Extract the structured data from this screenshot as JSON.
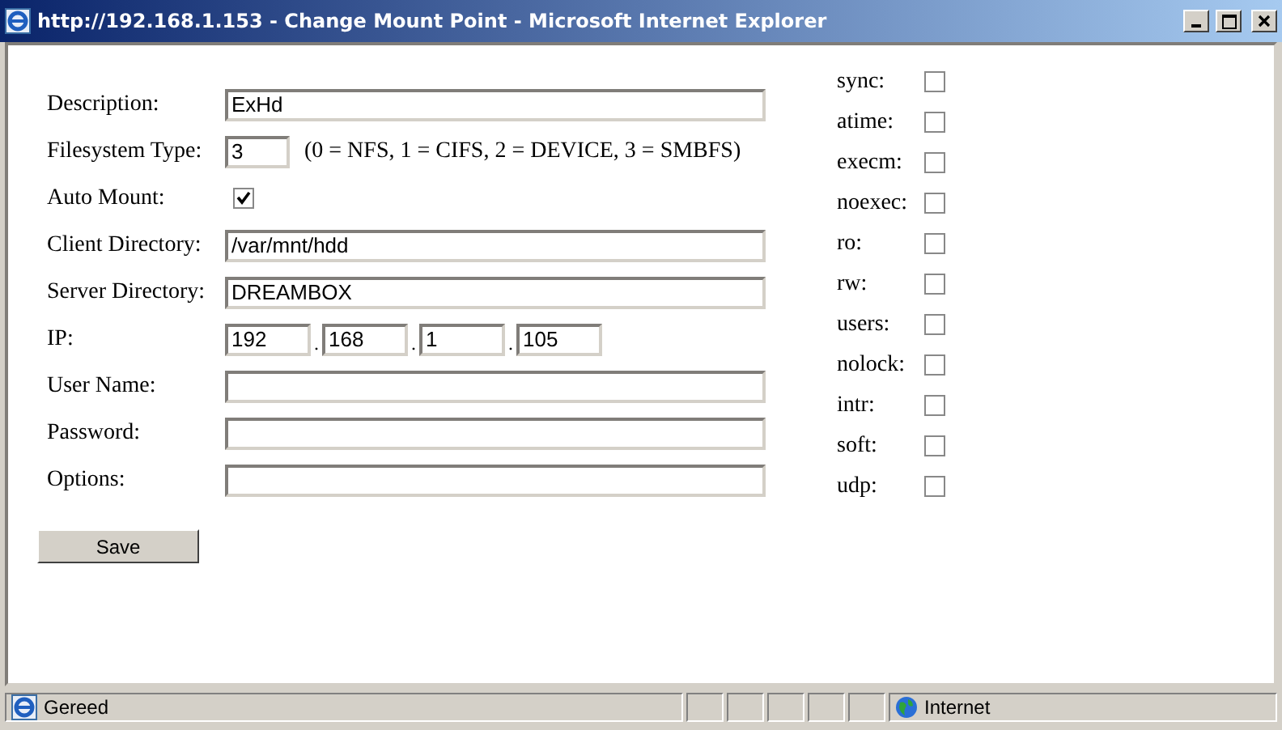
{
  "window": {
    "title": "http://192.168.1.153 - Change Mount Point - Microsoft Internet Explorer"
  },
  "form": {
    "fields": [
      {
        "kind": "text",
        "label": "Description:",
        "value": "ExHd"
      },
      {
        "kind": "short",
        "label": "Filesystem Type:",
        "value": "3",
        "note": "(0 = NFS, 1 = CIFS, 2 = DEVICE, 3 = SMBFS)"
      },
      {
        "kind": "checkbox",
        "label": "Auto Mount:",
        "checked": true
      },
      {
        "kind": "text",
        "label": "Client Directory:",
        "value": "/var/mnt/hdd"
      },
      {
        "kind": "text",
        "label": "Server Directory:",
        "value": "DREAMBOX"
      },
      {
        "kind": "ip",
        "label": "IP:",
        "parts": [
          "192",
          "168",
          "1",
          "105"
        ],
        "separator": "."
      },
      {
        "kind": "text",
        "label": "User Name:"
      },
      {
        "kind": "text",
        "label": "Password:"
      },
      {
        "kind": "text",
        "label": "Options:"
      }
    ],
    "save_button": "Save",
    "options": [
      {
        "label": "sync:",
        "checked": false
      },
      {
        "label": "atime:",
        "checked": false
      },
      {
        "label": "execm:",
        "checked": false
      },
      {
        "label": "noexec:",
        "checked": false
      },
      {
        "label": "ro:",
        "checked": false
      },
      {
        "label": "rw:",
        "checked": false
      },
      {
        "label": "users:",
        "checked": false
      },
      {
        "label": "nolock:",
        "checked": false
      },
      {
        "label": "intr:",
        "checked": false
      },
      {
        "label": "soft:",
        "checked": false
      },
      {
        "label": "udp:",
        "checked": false
      }
    ]
  },
  "status_bar": {
    "text": "Gereed",
    "zone": "Internet"
  }
}
